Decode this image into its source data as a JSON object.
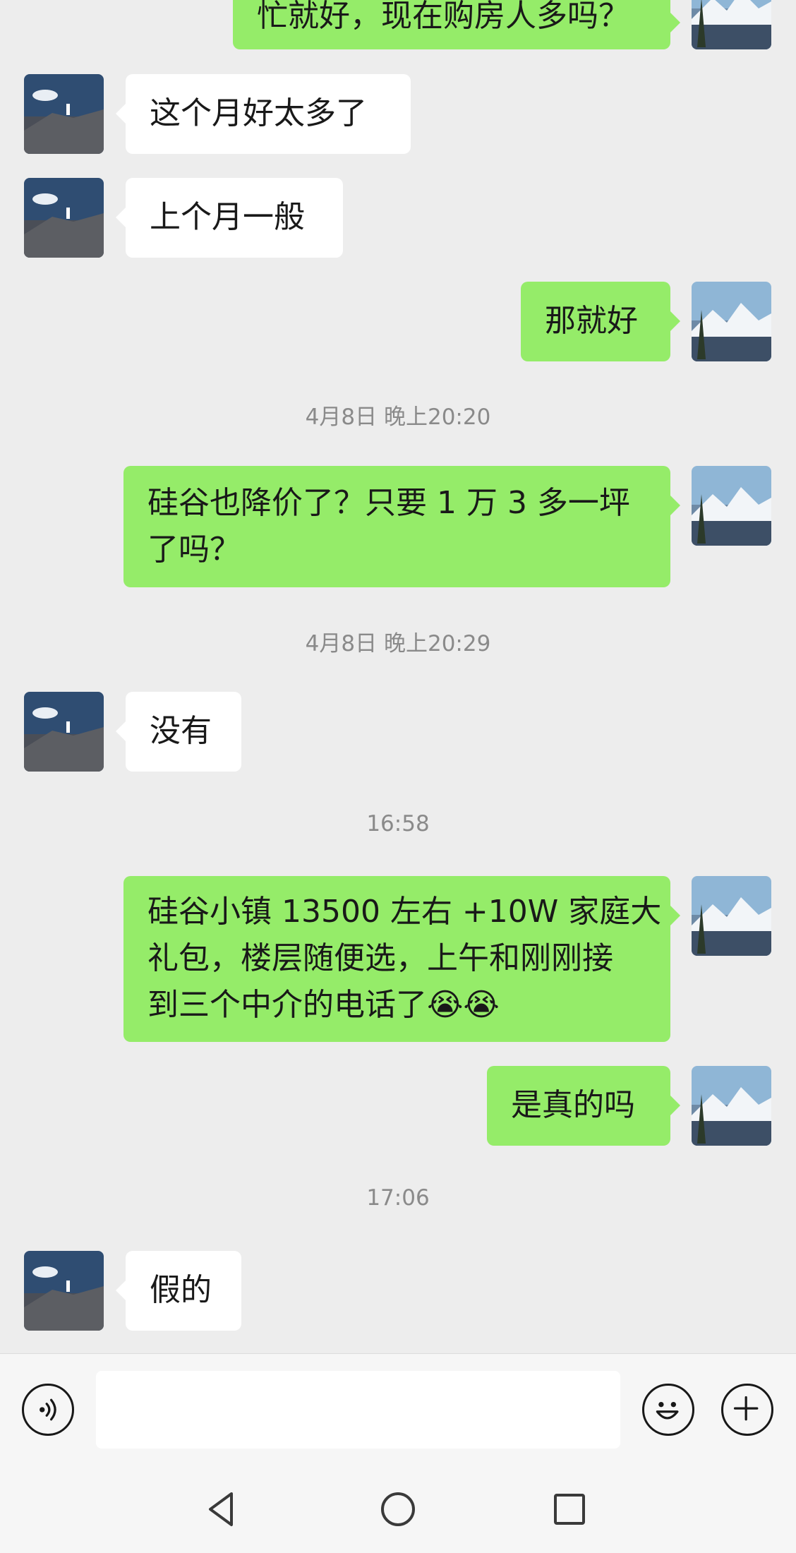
{
  "messages": [
    {
      "id": "m0",
      "side": "out",
      "lines": [
        "忙就好，现在购房人多吗？"
      ]
    },
    {
      "id": "m1",
      "side": "in",
      "lines": [
        "这个月好太多了"
      ]
    },
    {
      "id": "m2",
      "side": "in",
      "lines": [
        "上个月一般"
      ]
    },
    {
      "id": "m3",
      "side": "out",
      "lines": [
        "那就好"
      ]
    },
    {
      "id": "t1",
      "type": "time",
      "text": "4月8日 晚上20:20"
    },
    {
      "id": "m4",
      "side": "out",
      "lines": [
        "硅谷也降价了？只要 1 万 3 多一坪",
        "了吗？"
      ]
    },
    {
      "id": "t2",
      "type": "time",
      "text": "4月8日 晚上20:29"
    },
    {
      "id": "m5",
      "side": "in",
      "lines": [
        "没有"
      ]
    },
    {
      "id": "t3",
      "type": "time",
      "text": "16:58"
    },
    {
      "id": "m6",
      "side": "out",
      "lines": [
        "硅谷小镇 13500 左右 +10W 家庭大",
        "礼包，楼层随便选，上午和刚刚接",
        "到三个中介的电话了😭😭"
      ]
    },
    {
      "id": "m7",
      "side": "out",
      "lines": [
        "是真的吗"
      ]
    },
    {
      "id": "t4",
      "type": "time",
      "text": "17:06"
    },
    {
      "id": "m8",
      "side": "in",
      "lines": [
        "假的"
      ]
    }
  ],
  "input": {
    "placeholder": "",
    "value": ""
  },
  "icons": {
    "voice": "voice-icon",
    "emoji": "emoji-icon",
    "plus": "plus-icon",
    "back": "nav-back-icon",
    "home": "nav-home-icon",
    "recent": "nav-recent-icon"
  },
  "colors": {
    "background": "#ededed",
    "bubble_out": "#95ec69",
    "bubble_in": "#ffffff",
    "timestamp": "#8a8a8a"
  }
}
